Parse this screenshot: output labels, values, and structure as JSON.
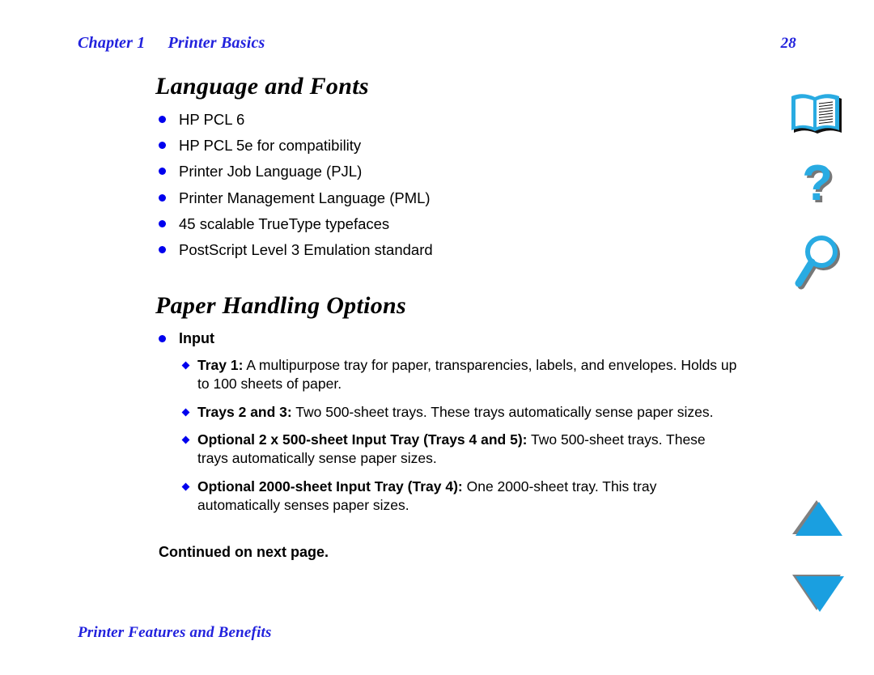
{
  "header": {
    "chapter_label": "Chapter 1",
    "chapter_title": "Printer Basics",
    "page_number": "28"
  },
  "sections": [
    {
      "heading": "Language and Fonts",
      "bullets": [
        "HP PCL 6",
        "HP PCL 5e for compatibility",
        "Printer Job Language (PJL)",
        "Printer Management Language (PML)",
        "45 scalable TrueType typefaces",
        "PostScript Level 3 Emulation standard"
      ]
    },
    {
      "heading": "Paper Handling Options",
      "group_label": "Input",
      "items": [
        {
          "term": "Tray 1:",
          "description": " A multipurpose tray for paper, transparencies, labels, and envelopes. Holds up to 100 sheets of paper."
        },
        {
          "term": "Trays 2 and 3:",
          "description": " Two 500-sheet trays. These trays automatically sense paper sizes."
        },
        {
          "term": "Optional 2 x 500-sheet Input Tray (Trays 4 and 5):",
          "description": " Two 500-sheet trays. These trays automatically sense paper sizes."
        },
        {
          "term": "Optional 2000-sheet Input Tray (Tray 4):",
          "description": " One 2000-sheet tray. This tray automatically senses paper sizes."
        }
      ],
      "continued_note": "Continued on next page."
    }
  ],
  "footer": {
    "text": "Printer Features and Benefits"
  },
  "nav_icons": [
    {
      "name": "book-icon",
      "label": "Table of contents"
    },
    {
      "name": "question-mark-icon",
      "label": "Help"
    },
    {
      "name": "magnifier-icon",
      "label": "Search"
    },
    {
      "name": "triangle-up-icon",
      "label": "Previous page"
    },
    {
      "name": "triangle-down-icon",
      "label": "Next page"
    }
  ],
  "colors": {
    "header_blue": "#2222dd",
    "bullet_blue": "#0000ee",
    "icon_cyan": "#29abe2",
    "icon_shadow": "#808080",
    "text_black": "#000000",
    "page_background": "#ffffff"
  }
}
